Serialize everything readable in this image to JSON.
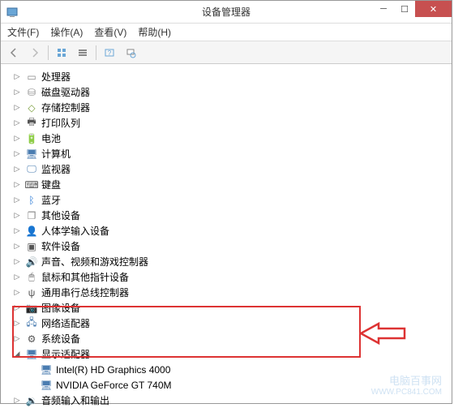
{
  "window": {
    "title": "设备管理器"
  },
  "menu": {
    "file": "文件(F)",
    "action": "操作(A)",
    "view": "查看(V)",
    "help": "帮助(H)"
  },
  "toolbar_icons": {
    "back": "back-icon",
    "forward": "forward-icon",
    "divider": "|",
    "props": "properties-icon",
    "devices": "devices-icon",
    "monitors": "monitors-icon",
    "scan": "scan-icon"
  },
  "tree": [
    {
      "label": "处理器",
      "icon": "cpu-icon",
      "expanded": false
    },
    {
      "label": "磁盘驱动器",
      "icon": "disk-icon",
      "expanded": false
    },
    {
      "label": "存储控制器",
      "icon": "storage-icon",
      "expanded": false
    },
    {
      "label": "打印队列",
      "icon": "printer-icon",
      "expanded": false
    },
    {
      "label": "电池",
      "icon": "battery-icon",
      "expanded": false
    },
    {
      "label": "计算机",
      "icon": "computer-icon",
      "expanded": false
    },
    {
      "label": "监视器",
      "icon": "monitor-icon",
      "expanded": false
    },
    {
      "label": "键盘",
      "icon": "keyboard-icon",
      "expanded": false
    },
    {
      "label": "蓝牙",
      "icon": "bluetooth-icon",
      "expanded": false
    },
    {
      "label": "其他设备",
      "icon": "other-icon",
      "expanded": false
    },
    {
      "label": "人体学输入设备",
      "icon": "hid-icon",
      "expanded": false
    },
    {
      "label": "软件设备",
      "icon": "software-icon",
      "expanded": false
    },
    {
      "label": "声音、视频和游戏控制器",
      "icon": "audio-icon",
      "expanded": false
    },
    {
      "label": "鼠标和其他指针设备",
      "icon": "mouse-icon",
      "expanded": false
    },
    {
      "label": "通用串行总线控制器",
      "icon": "usb-icon",
      "expanded": false
    },
    {
      "label": "图像设备",
      "icon": "image-icon",
      "expanded": false
    },
    {
      "label": "网络适配器",
      "icon": "network-icon",
      "expanded": false
    },
    {
      "label": "系统设备",
      "icon": "system-icon",
      "expanded": false
    },
    {
      "label": "显示适配器",
      "icon": "display-icon",
      "expanded": true,
      "children": [
        {
          "label": "Intel(R) HD Graphics 4000",
          "icon": "gpu-icon"
        },
        {
          "label": "NVIDIA GeForce GT 740M",
          "icon": "gpu-icon"
        }
      ]
    },
    {
      "label": "音频输入和输出",
      "icon": "audioio-icon",
      "expanded": false
    }
  ],
  "icons": {
    "cpu-icon": "▭",
    "disk-icon": "⛁",
    "storage-icon": "◇",
    "printer-icon": "🖶",
    "battery-icon": "🔋",
    "computer-icon": "🖥",
    "monitor-icon": "🖵",
    "keyboard-icon": "⌨",
    "bluetooth-icon": "ᛒ",
    "other-icon": "❐",
    "hid-icon": "👤",
    "software-icon": "▣",
    "audio-icon": "🔊",
    "mouse-icon": "🖱",
    "usb-icon": "ψ",
    "image-icon": "📷",
    "network-icon": "🖧",
    "system-icon": "⚙",
    "display-icon": "🖥",
    "gpu-icon": "🖥",
    "audioio-icon": "🔉"
  },
  "annotation": {
    "arrow_color": "#d33",
    "highlight_color": "#d33"
  },
  "watermark": {
    "text1": "电脑百事网",
    "text2": "WWW.PC841.COM"
  }
}
